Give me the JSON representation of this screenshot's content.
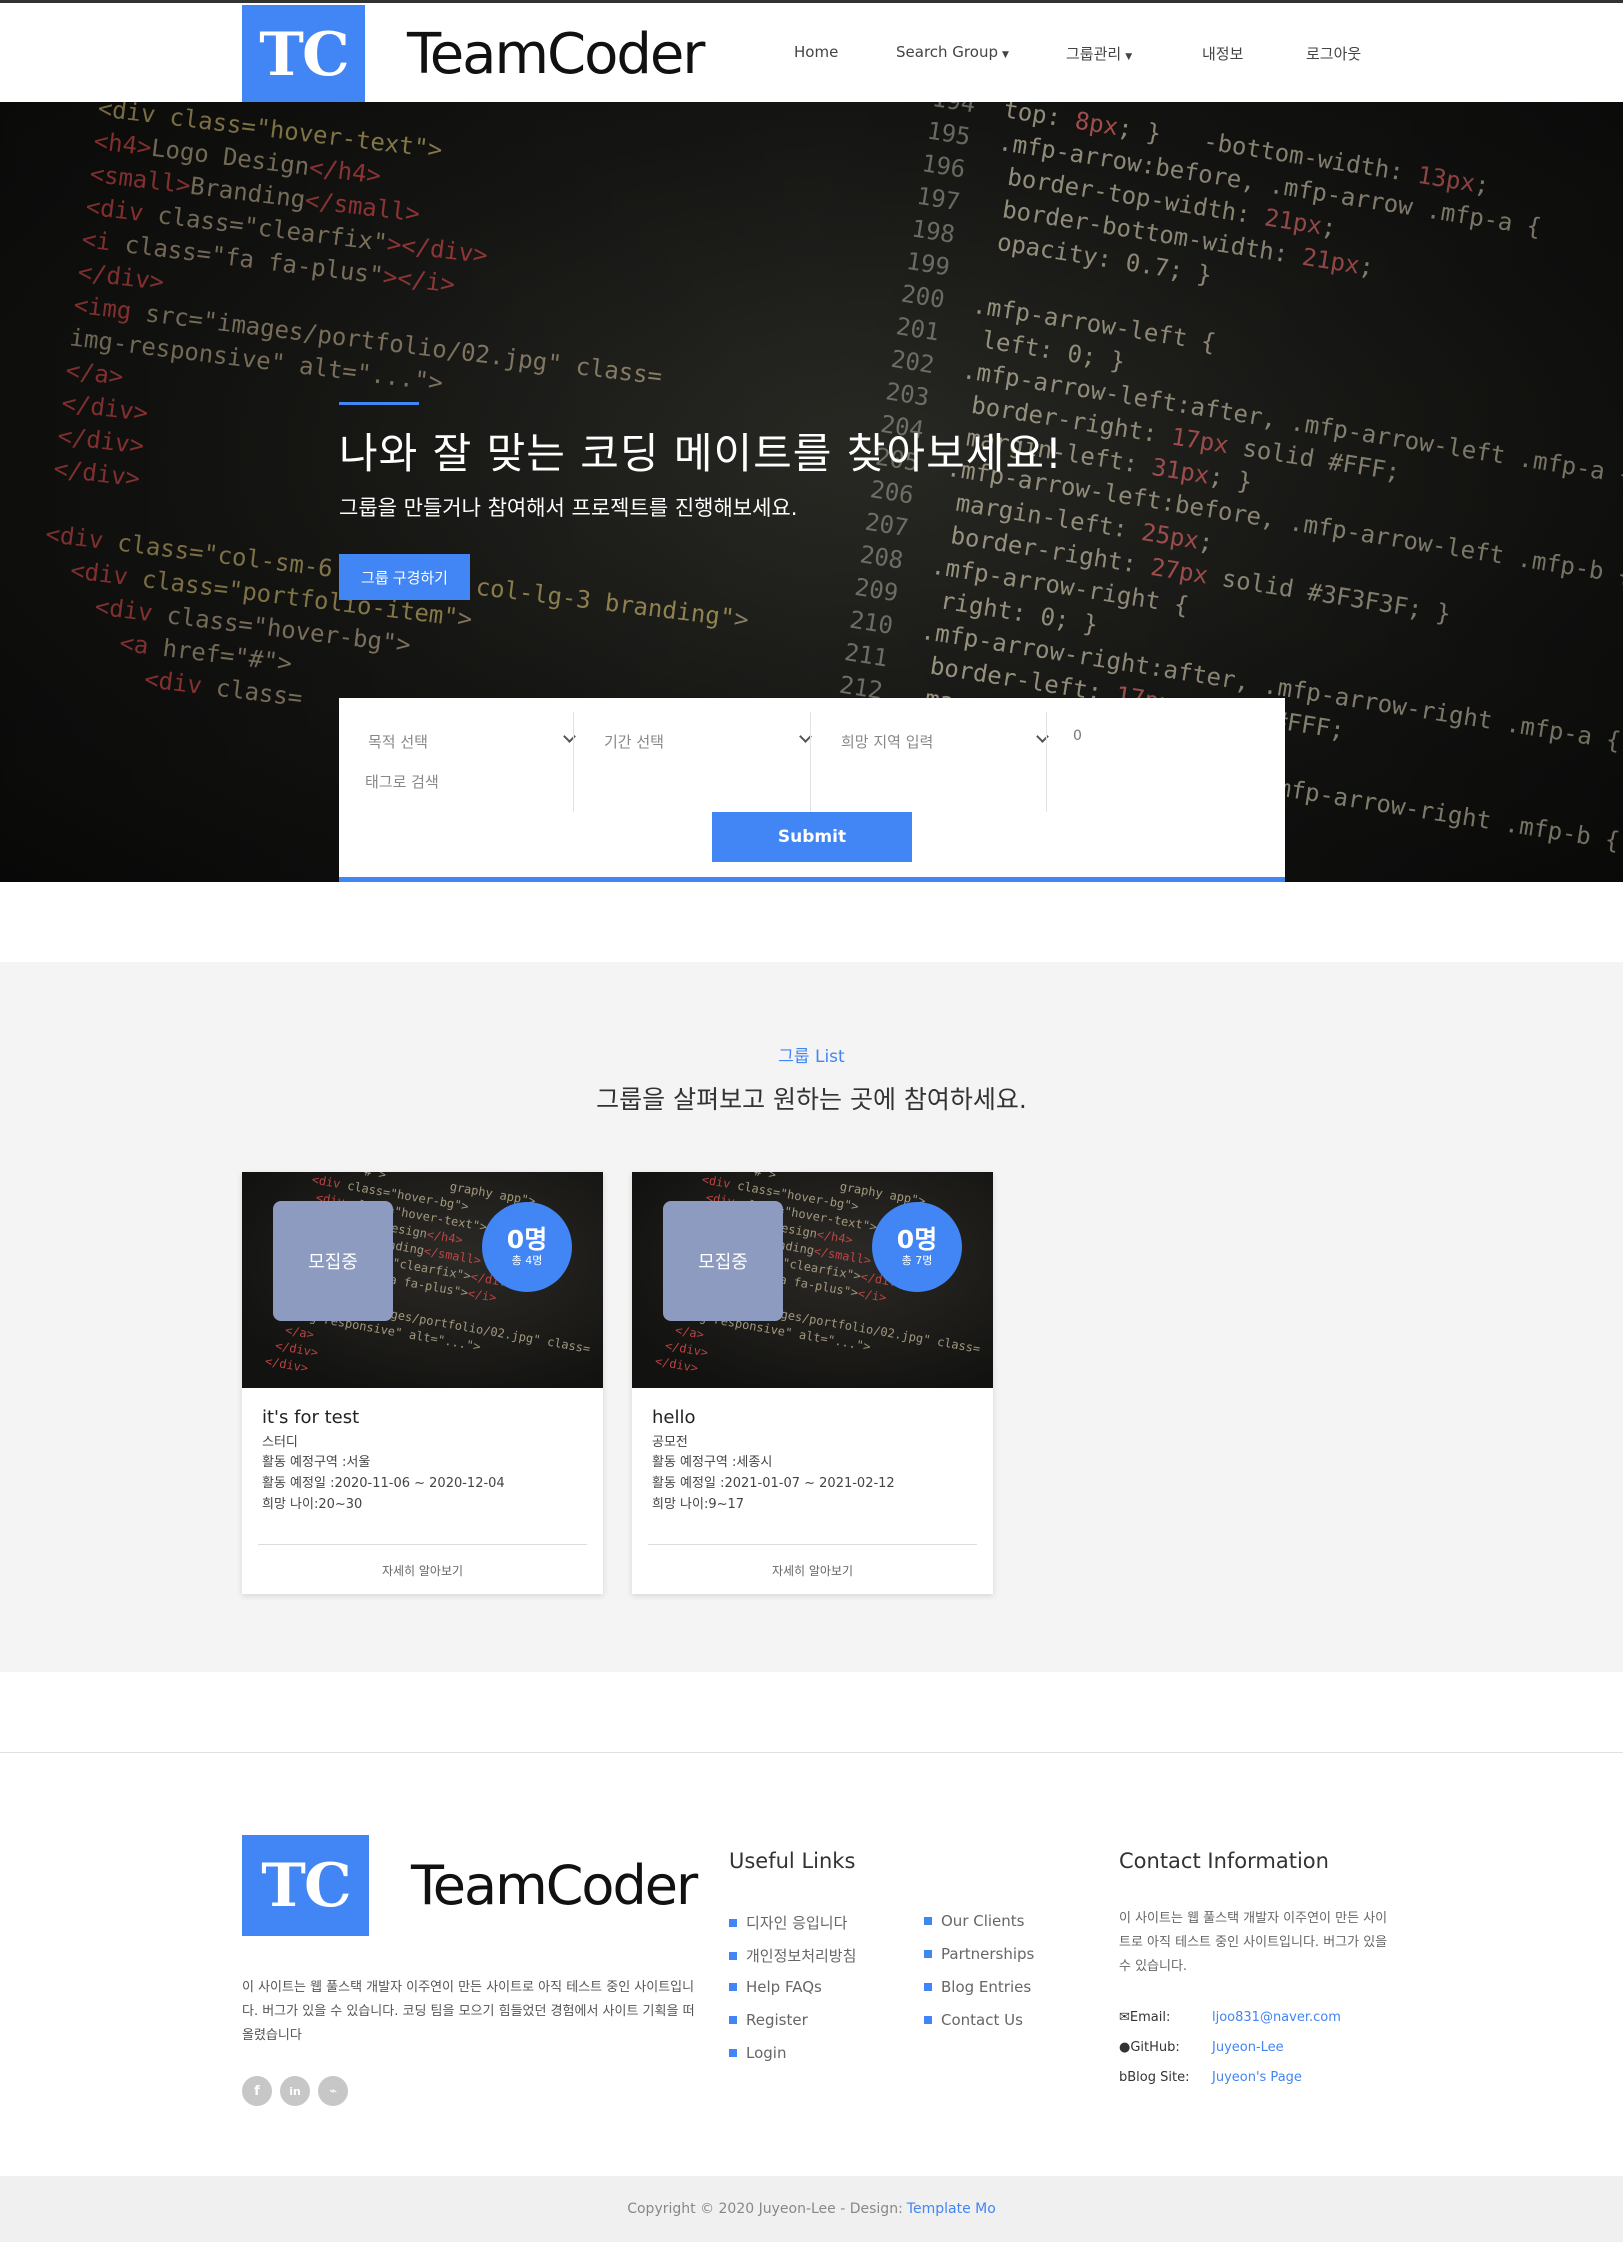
{
  "header": {
    "logo_mark": "TC",
    "logo_text": "TeamCoder",
    "nav": [
      {
        "label": "Home",
        "dropdown": false
      },
      {
        "label": "Search Group",
        "dropdown": true
      },
      {
        "label": "그룹관리",
        "dropdown": true
      },
      {
        "label": "내정보",
        "dropdown": false
      },
      {
        "label": "로그아웃",
        "dropdown": false
      }
    ]
  },
  "hero": {
    "title": "나와 잘 맞는 코딩 메이트를 찾아보세요!",
    "subtitle": "그룹을 만들거나 참여해서 프로젝트를 진행해보세요.",
    "button_label": "그룹 구경하기",
    "search": {
      "purpose_select": "목적 선택",
      "period_select": "기간 선택",
      "region_select": "희망 지역 입력",
      "number_value": "0",
      "tag_placeholder": "태그로 검색",
      "submit_label": "Submit"
    }
  },
  "groups": {
    "kicker": "그룹 List",
    "heading": "그룹을 살펴보고 원하는 곳에 참여하세요.",
    "more_label": "자세히 알아보기",
    "cards": [
      {
        "status": "모집중",
        "count": "0명",
        "total": "총 4명",
        "title": "it's for test",
        "type": "스터디",
        "region": "활동 예정구역 :서울",
        "dates": "활동 예정일 :2020-11-06 ~ 2020-12-04",
        "age": "희망 나이:20~30"
      },
      {
        "status": "모집중",
        "count": "0명",
        "total": "총 7명",
        "title": "hello",
        "type": "공모전",
        "region": "활동 예정구역 :세종시",
        "dates": "활동 예정일 :2021-01-07 ~ 2021-02-12",
        "age": "희망 나이:9~17"
      }
    ]
  },
  "footer": {
    "logo_mark": "TC",
    "logo_text": "TeamCoder",
    "about": "이 사이트는 웹 풀스택 개발자 이주연이 만든 사이트로 아직 테스트 중인 사이트입니다. 버그가 있을 수 있습니다. 코딩 팀을 모으기 힘들었던 경험에서 사이트 기획을 떠올렸습니다",
    "social": [
      {
        "icon": "facebook-icon",
        "glyph": "f"
      },
      {
        "icon": "linkedin-icon",
        "glyph": "in"
      },
      {
        "icon": "rss-icon",
        "glyph": "⌁"
      }
    ],
    "useful_links_heading": "Useful Links",
    "links_col1": [
      "디자인 응입니다",
      "개인정보처리방침",
      "Help FAQs",
      "Register",
      "Login"
    ],
    "links_col2": [
      "Our Clients",
      "Partnerships",
      "Blog Entries",
      "Contact Us"
    ],
    "contact_heading": "Contact Information",
    "contact_desc": "이 사이트는 웹 풀스택 개발자 이주연이 만든 사이트로 아직 테스트 중인 사이트입니다. 버그가 있을 수 있습니다.",
    "contacts": [
      {
        "icon": "envelope-icon",
        "label": "Email:",
        "value": "ljoo831@naver.com"
      },
      {
        "icon": "github-icon",
        "label": "GitHub:",
        "value": "Juyeon-Lee"
      },
      {
        "icon": "blog-icon",
        "label": "Blog Site:",
        "value": "Juyeon's Page"
      }
    ],
    "copyright_text": "Copyright © 2020 Juyeon-Lee - Design:",
    "copyright_link": "Template Mo"
  },
  "colors": {
    "accent": "#4285f4",
    "status_box": "#8c9bbf",
    "section_bg": "#f4f4f4"
  }
}
